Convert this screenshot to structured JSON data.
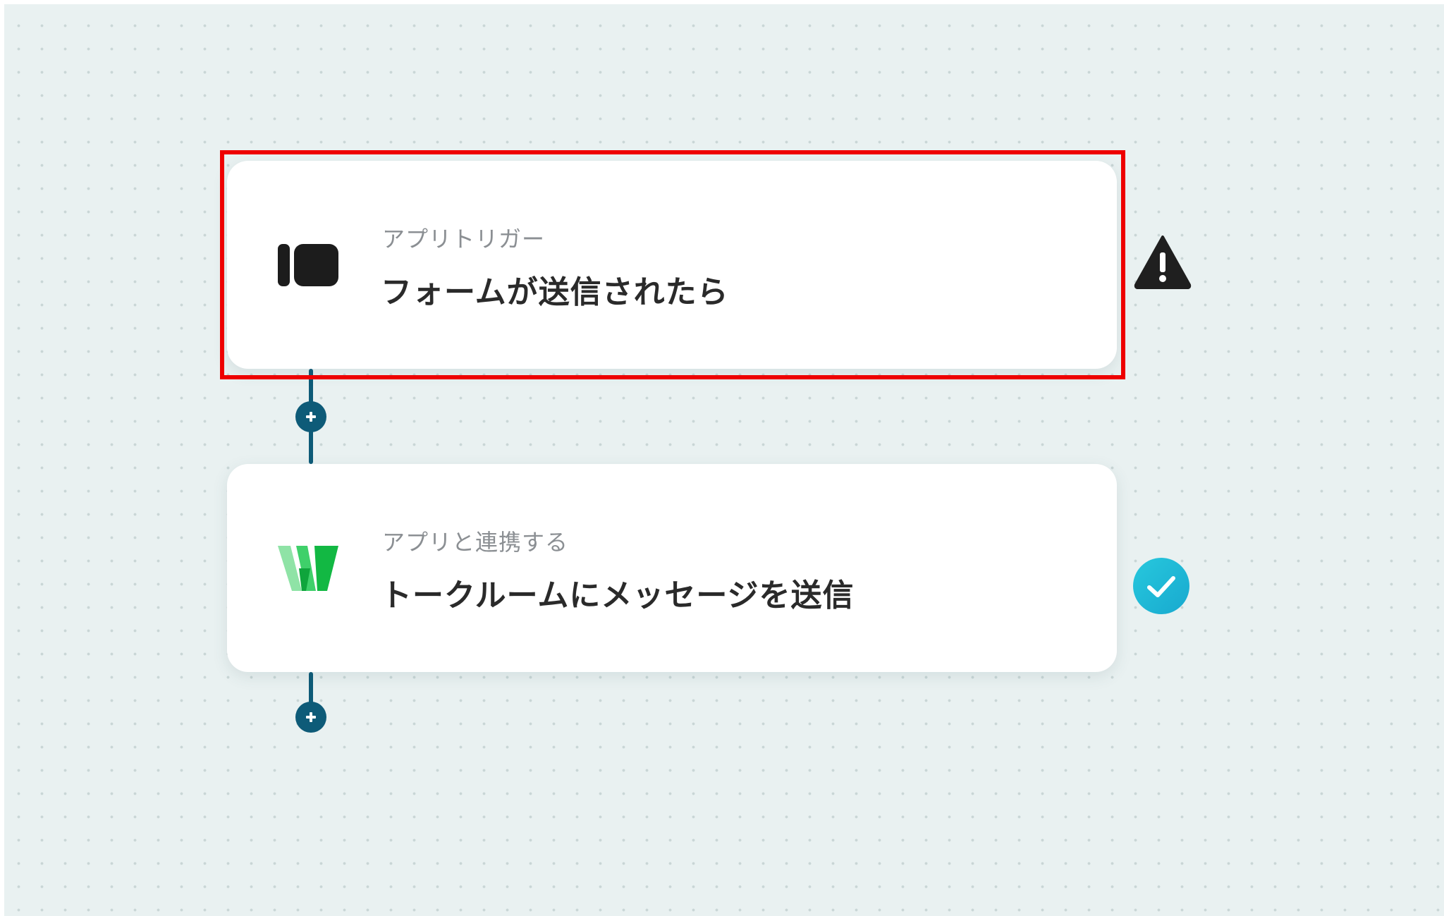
{
  "flow": {
    "steps": [
      {
        "subtitle": "アプリトリガー",
        "title": "フォームが送信されたら",
        "app_icon": "form-app-icon",
        "status": "warning",
        "status_icon": "warning-triangle-icon",
        "highlighted": true
      },
      {
        "subtitle": "アプリと連携する",
        "title": "トークルームにメッセージを送信",
        "app_icon": "line-works-icon",
        "status": "complete",
        "status_icon": "check-circle-icon",
        "highlighted": false
      }
    ],
    "add_step_icon": "plus-icon"
  },
  "colors": {
    "canvas_background": "#e9f1f1",
    "connector": "#0e5b78",
    "highlight": "#ee0000",
    "check": "#1cb8d6",
    "warning": "#1f1f1f",
    "line_works_green": "#16c24a"
  }
}
